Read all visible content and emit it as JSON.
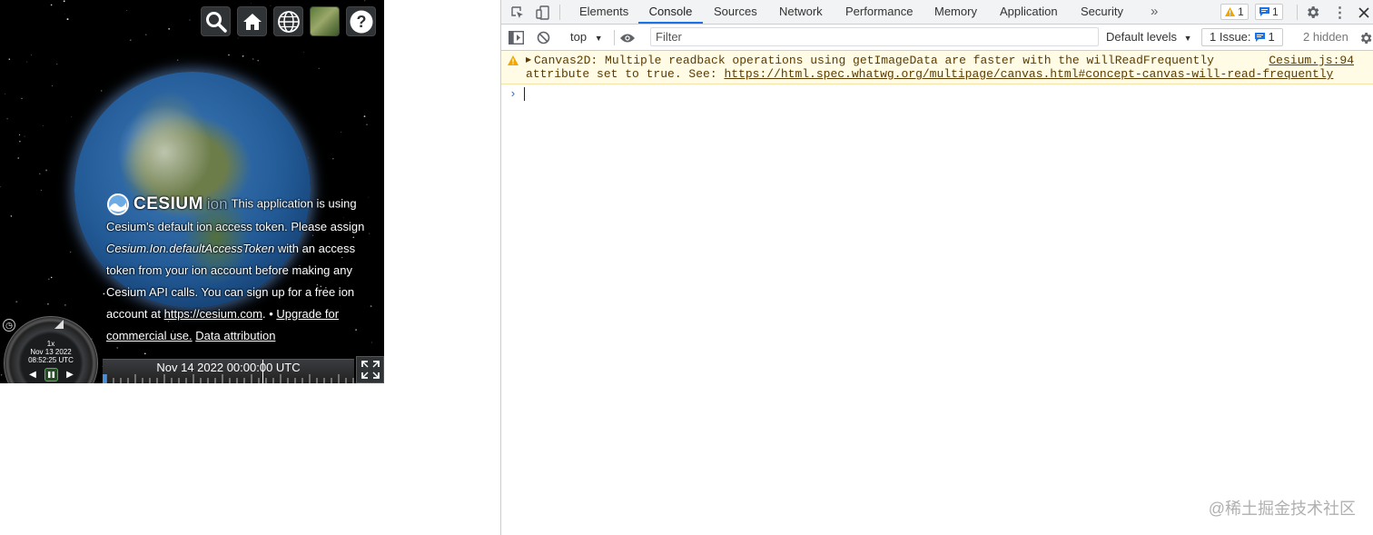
{
  "viewer": {
    "toolbar": [
      {
        "name": "search-button",
        "icon": "search-icon"
      },
      {
        "name": "home-button",
        "icon": "home-icon"
      },
      {
        "name": "scene-mode-button",
        "icon": "globe-icon"
      },
      {
        "name": "base-layer-picker-button",
        "icon": "imagery-icon"
      },
      {
        "name": "navigation-help-button",
        "icon": "question-icon"
      }
    ],
    "credit": {
      "logo_word": "CESIUM",
      "logo_ion": "ion",
      "text1": "This application is using Cesium's default ion access token. Please assign ",
      "token": "Cesium.Ion.defaultAccessToken",
      "text2": " with an access token from your ion account before making any Cesium API calls. You can sign up for a free ion account at ",
      "link": "https://cesium.com",
      "text3": ". • ",
      "upgrade": "Upgrade for commercial use.",
      "attribution": "Data attribution"
    },
    "animation": {
      "speed": "1x",
      "date": "Nov 13 2022",
      "time": "08:52:25 UTC"
    },
    "timeline": {
      "label": "Nov 14 2022 00:00:00 UTC"
    }
  },
  "devtools": {
    "tabs": [
      "Elements",
      "Console",
      "Sources",
      "Network",
      "Performance",
      "Memory",
      "Application",
      "Security"
    ],
    "active_tab": "Console",
    "more": "»",
    "warnings_count": "1",
    "messages_count": "1",
    "context": "top",
    "filter_placeholder": "Filter",
    "levels": "Default levels",
    "issues_label": "1 Issue:",
    "issues_count": "1",
    "hidden": "2 hidden",
    "warning": {
      "line1": "Canvas2D: Multiple readback operations using getImageData are faster with the willReadFrequently",
      "line2_prefix": "attribute set to true. See: ",
      "link": "https://html.spec.whatwg.org/multipage/canvas.html#concept-canvas-will-read-frequently",
      "source": "Cesium.js:94"
    },
    "prompt": "›"
  },
  "watermark": "@稀土掘金技术社区",
  "colors": {
    "accent": "#1a73e8",
    "warning_bg": "#fffbe5",
    "warning_text": "#5c3c00"
  }
}
